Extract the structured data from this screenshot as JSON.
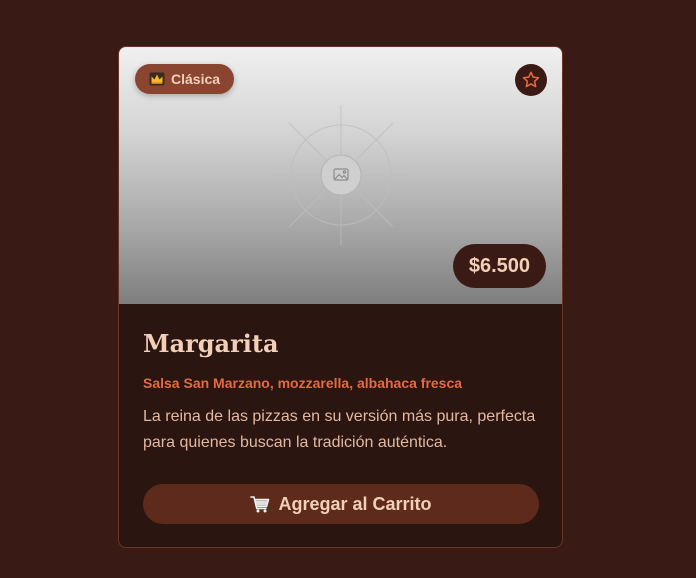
{
  "product": {
    "badge": {
      "icon": "crown-icon",
      "label": "Clásica"
    },
    "favorite_icon": "star-outline-icon",
    "price": "$6.500",
    "name": "Margarita",
    "ingredients": "Salsa San Marzano, mozzarella, albahaca fresca",
    "description": "La reina de las pizzas en su versión más pura, perfecta para quienes buscan la tradición auténtica.",
    "add_button": {
      "icon": "cart-icon",
      "label": "Agregar al Carrito"
    }
  },
  "colors": {
    "page_background": "#3a1a14",
    "card_background": "#2a1510",
    "card_border": "#6a3424",
    "accent": "#e26b43",
    "badge_background": "#8a4530",
    "button_background": "#5e2a1c",
    "text_light": "#f2d0b8"
  }
}
